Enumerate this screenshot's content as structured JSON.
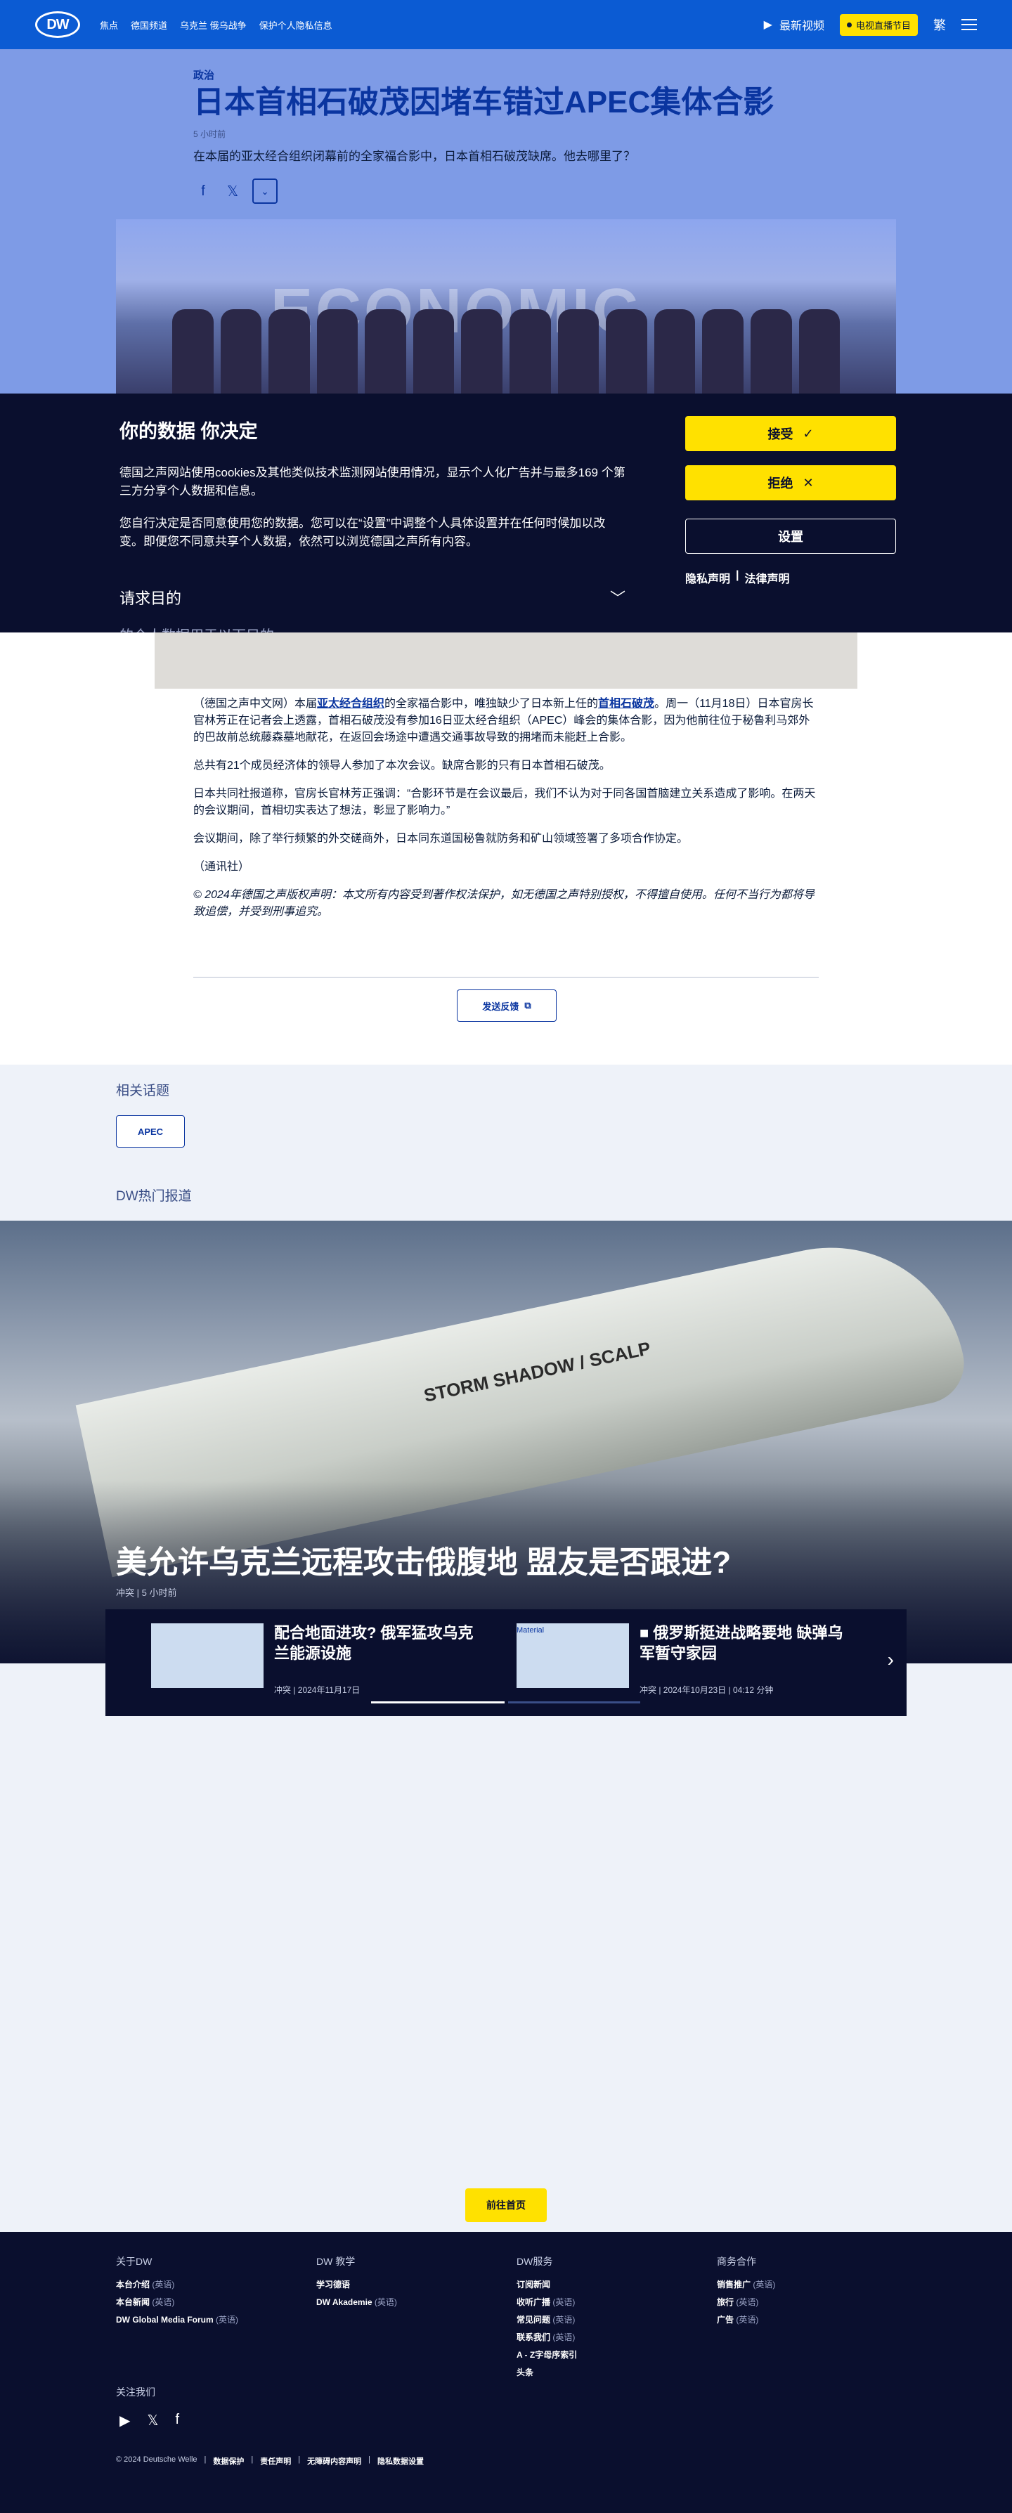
{
  "nav": {
    "logo": "DW",
    "items": [
      "焦点",
      "德国频道",
      "乌克兰 俄乌战争",
      "保护个人隐私信息"
    ],
    "live_label": "最新视频",
    "tv_label": "电视直播节目",
    "lang_label": "繁"
  },
  "article": {
    "kicker": "政治",
    "headline": "日本首相石破茂因堵车错过APEC集体合影",
    "time_ago": "5 小时前",
    "lead": "在本届的亚太经合组织闭幕前的全家福合影中，日本首相石破茂缺席。他去哪里了？",
    "photo_banner": "ECONOMIC",
    "para1_before": "（德国之声中文网）本届",
    "para1_link1": "亚太经合组织",
    "para1_mid": "的全家福合影中，唯独缺少了日本新上任的",
    "para1_link2": "首相石破茂",
    "para1_after": "。周一（11月18日）日本官房长官林芳正在记者会上透露，首相石破茂没有参加16日亚太经合组织（APEC）峰会的集体合影，因为他前往位于秘鲁利马郊外的巴故前总统藤森墓地献花，在返回会场途中遭遇交通事故导致的拥堵而未能赶上合影。",
    "para2": "总共有21个成员经济体的领导人参加了本次会议。缺席合影的只有日本首相石破茂。",
    "para3": "日本共同社报道称，官房长官林芳正强调：“合影环节是在会议最后，我们不认为对于同各国首脑建立关系造成了影响。在两天的会议期间，首相切实表达了想法，彰显了影响力。”",
    "para4": "会议期间，除了举行频繁的外交磋商外，日本同东道国秘鲁就防务和矿山领域签署了多项合作协定。",
    "para5": "（通讯社）",
    "copyright": "© 2024年德国之声版权声明：本文所有内容受到著作权法保护，如无德国之声特别授权，不得擅自使用。任何不当行为都将导致追偿，并受到刑事追究。",
    "feedback_label": "发送反馈"
  },
  "consent": {
    "title": "你的数据 你决定",
    "p1": "德国之声网站使用cookies及其他类似技术监测网站使用情况，显示个人化广告并与最多169 个第三方分享个人数据和信息。",
    "p2": "您自行决定是否同意使用您的数据。您可以在“设置”中调整个人具体设置并在任何时候加以改变。即便您不同意共享个人数据，依然可以浏览德国之声所有内容。",
    "purpose_label": "请求目的",
    "cut_text": "的个人数据用于以下目的",
    "accept_label": "接受",
    "reject_label": "拒绝",
    "settings_label": "设置",
    "privacy_label": "隐私声明",
    "legal_label": "法律声明"
  },
  "related": {
    "title": "相关话题",
    "tag": "APEC"
  },
  "hot": {
    "title": "DW热门报道",
    "feature_title": "美允许乌克兰远程攻击俄腹地 盟友是否跟进?",
    "feature_meta": "冲突 | 5 小时前",
    "missile_text": "STORM SHADOW / SCALP",
    "cards": [
      {
        "title": "配合地面进攻? 俄军猛攻乌克兰能源设施",
        "meta": "冲突 | 2024年11月17日"
      },
      {
        "title": "俄罗斯挺进战略要地 缺弹乌军暂守家园",
        "meta": "冲突 | 2024年10月23日 | 04:12 分钟",
        "thumb_alt": "Material"
      }
    ]
  },
  "home_label": "前往首页",
  "footer": {
    "cols": [
      {
        "title": "关于DW",
        "links": [
          {
            "name": "本台介绍",
            "note": "(英语)"
          },
          {
            "name": "本台新闻",
            "note": "(英语)"
          },
          {
            "name": "DW Global Media Forum",
            "note": "(英语)"
          }
        ]
      },
      {
        "title": "DW 教学",
        "links": [
          {
            "name": "学习德语",
            "note": ""
          },
          {
            "name": "DW Akademie",
            "note": "(英语)"
          }
        ]
      },
      {
        "title": "DW服务",
        "links": [
          {
            "name": "订阅新闻",
            "note": ""
          },
          {
            "name": "收听广播",
            "note": "(英语)"
          },
          {
            "name": "常见问题",
            "note": "(英语)"
          },
          {
            "name": "联系我们",
            "note": "(英语)"
          },
          {
            "name": "A - Z字母序索引",
            "note": ""
          },
          {
            "name": "头条",
            "note": ""
          }
        ]
      },
      {
        "title": "商务合作",
        "links": [
          {
            "name": "销售推广",
            "note": "(英语)"
          },
          {
            "name": "旅行",
            "note": "(英语)"
          },
          {
            "name": "广告",
            "note": "(英语)"
          }
        ]
      }
    ],
    "follow_label": "关注我们",
    "copyright": "© 2024 Deutsche Welle",
    "bottom_links": [
      "数据保护",
      "责任声明",
      "无障碍内容声明",
      "隐私数据设置"
    ]
  },
  "colors": {
    "brand_blue": "#0b5bd3",
    "accent_yellow": "#ffe100",
    "dark_navy": "#0a0f2e"
  }
}
